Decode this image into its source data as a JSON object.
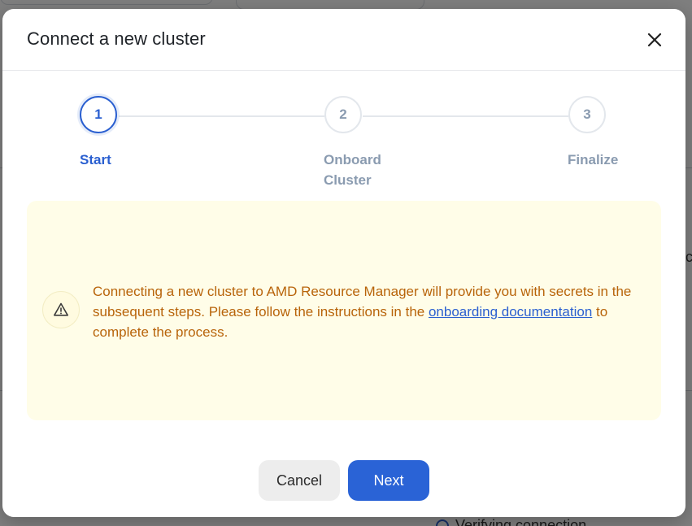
{
  "background": {
    "fragment_right": "ıc",
    "fragment_bottom": "Verifying connection"
  },
  "modal": {
    "title": "Connect a new cluster",
    "close_icon": "close-icon"
  },
  "stepper": {
    "steps": [
      {
        "number": "1",
        "label": "Start",
        "state": "active"
      },
      {
        "number": "2",
        "label": "Onboard Cluster",
        "state": "inactive"
      },
      {
        "number": "3",
        "label": "Finalize",
        "state": "inactive"
      }
    ]
  },
  "alert": {
    "icon": "warning-icon",
    "text_before": "Connecting a new cluster to AMD Resource Manager will provide you with secrets in the subsequent steps. Please follow the instructions in the ",
    "link_text": "onboarding documentation",
    "text_after": " to complete the process."
  },
  "footer": {
    "cancel_label": "Cancel",
    "next_label": "Next"
  },
  "colors": {
    "primary": "#2a63d6",
    "step_active": "#2a5fd0",
    "step_inactive": "#8a9bb0",
    "alert_background": "#fffde8",
    "alert_text": "#b8640a"
  }
}
